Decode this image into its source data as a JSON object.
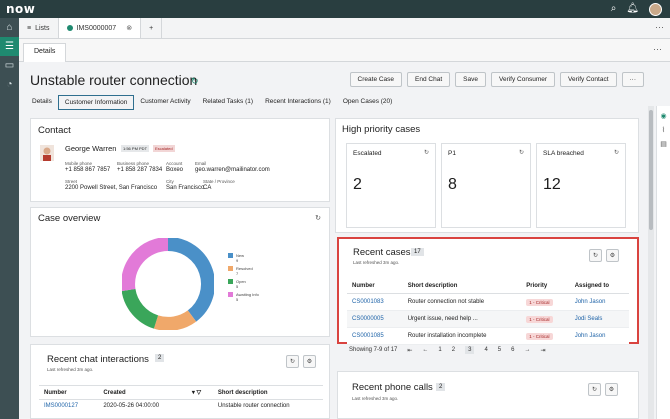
{
  "app": {
    "logo": "now"
  },
  "tabs": {
    "lists_label": "Lists",
    "record_label": "IMS0000007",
    "add": "+",
    "more": "···"
  },
  "subtab": {
    "label": "Details",
    "more": "···"
  },
  "record": {
    "title": "Unstable router connection"
  },
  "actions": [
    "Create Case",
    "End Chat",
    "Save",
    "Verify Consumer",
    "Verify Contact"
  ],
  "actions_more": "···",
  "detail_tabs": [
    "Details",
    "Customer Information",
    "Customer Activity",
    "Related Tasks (1)",
    "Recent Interactions (1)",
    "Open Cases (20)"
  ],
  "contact": {
    "heading": "Contact",
    "name": "George Warren",
    "time_badge": "1:56 PM PDT",
    "escalated_badge": "Escalated",
    "mobile_label": "Mobile phone",
    "mobile": "+1 858 867 7857",
    "business_label": "Business phone",
    "business": "+1 858 287 7834",
    "account_label": "Account",
    "account": "Boxeo",
    "email_label": "Email",
    "email": "geo.warren@mailinator.com",
    "street_label": "Street",
    "street": "2200 Powell Street, San Francisco",
    "city_label": "City",
    "city": "San Francisco",
    "state_label": "State / Province",
    "state": "CA"
  },
  "case_overview": {
    "heading": "Case overview",
    "legend": [
      {
        "label": "New",
        "count": "9",
        "color": "#4a90c8"
      },
      {
        "label": "Resolved",
        "count": "7",
        "color": "#f0a86a"
      },
      {
        "label": "Open",
        "count": "5",
        "color": "#3aa65a"
      },
      {
        "label": "Awaiting Info",
        "count": "5",
        "color": "#e27ad8"
      }
    ]
  },
  "high_priority": {
    "heading": "High priority cases",
    "cards": [
      {
        "label": "Escalated",
        "value": "2"
      },
      {
        "label": "P1",
        "value": "8"
      },
      {
        "label": "SLA breached",
        "value": "12"
      }
    ]
  },
  "recent_cases": {
    "heading": "Recent cases",
    "count": "17",
    "refreshed": "Last refreshed 3m ago.",
    "columns": [
      "Number",
      "Short description",
      "Priority",
      "Assigned to"
    ],
    "rows": [
      {
        "number": "CS0001083",
        "desc": "Router connection not stable",
        "priority": "1 - Critical",
        "assigned": "John Jason"
      },
      {
        "number": "CS0000005",
        "desc": "Urgent issue, need help ...",
        "priority": "1 - Critical",
        "assigned": "Jodi Seals"
      },
      {
        "number": "CS0001085",
        "desc": "Router installation incomplete",
        "priority": "1 - Critical",
        "assigned": "John Jason"
      }
    ],
    "pager": {
      "showing": "Showing 7-9 of 17",
      "first": "⇤",
      "prev": "←",
      "pages": [
        "1",
        "2",
        "3",
        "4",
        "5",
        "6"
      ],
      "next": "→",
      "last": "⇥"
    }
  },
  "recent_chat": {
    "heading": "Recent chat interactions",
    "count": "2",
    "refreshed": "Last refreshed 3m ago.",
    "columns": [
      "Number",
      "Created",
      "Short description"
    ],
    "rows": [
      {
        "number": "IMS0000127",
        "created": "2020-05-26 04:00:00",
        "desc": "Unstable router connection"
      }
    ]
  },
  "recent_phone": {
    "heading": "Recent phone calls",
    "count": "2",
    "refreshed": "Last refreshed 3m ago."
  }
}
